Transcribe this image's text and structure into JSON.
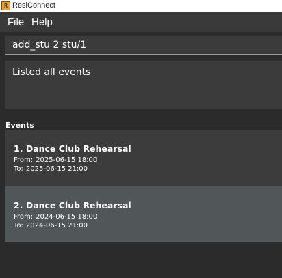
{
  "window": {
    "title": "ResiConnect",
    "icon": "app-icon"
  },
  "menu": {
    "items": [
      "File",
      "Help"
    ]
  },
  "command": {
    "value": "add_stu 2 stu/1"
  },
  "result": {
    "text": "Listed all events"
  },
  "events": {
    "header": "Events",
    "items": [
      {
        "index": "1.",
        "name": "Dance Club Rehearsal",
        "from_label": "From:",
        "from": "2025-06-15 18:00",
        "to_label": "To:",
        "to": "2025-06-15 21:00",
        "selected": false
      },
      {
        "index": "2.",
        "name": "Dance Club Rehearsal",
        "from_label": "From:",
        "from": "2024-06-15 18:00",
        "to_label": "To:",
        "to": "2024-06-15 21:00",
        "selected": true
      }
    ]
  },
  "colors": {
    "background": "#2b2b2b",
    "panel": "#3b3b3b",
    "selected_card": "#515658",
    "text": "#ffffff"
  }
}
